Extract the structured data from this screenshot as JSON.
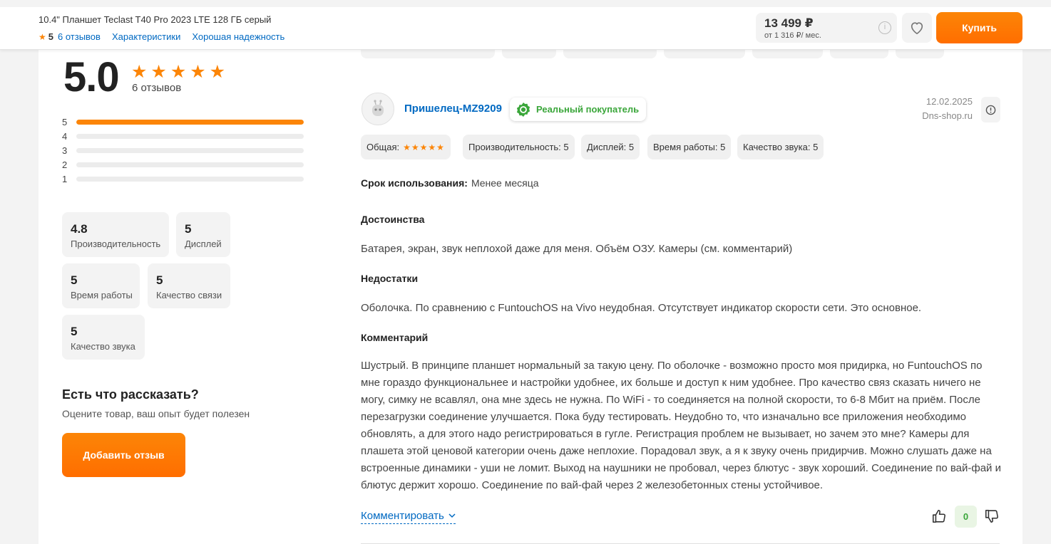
{
  "product": {
    "title": "10.4\" Планшет Teclast T40 Pro 2023 LTE 128 ГБ серый",
    "rating": "5",
    "links": [
      "6 отзывов",
      "Характеристики",
      "Хорошая надежность"
    ],
    "price": "13 499 ₽",
    "credit": "от 1 316 ₽/ мес.",
    "buy_label": "Купить"
  },
  "summary": {
    "rating": "5.0",
    "stars": "★★★★★",
    "count": "6 отзывов",
    "distribution": [
      {
        "label": "5",
        "fraction": 1.0
      },
      {
        "label": "4",
        "fraction": 0
      },
      {
        "label": "3",
        "fraction": 0
      },
      {
        "label": "2",
        "fraction": 0
      },
      {
        "label": "1",
        "fraction": 0
      }
    ],
    "stats": [
      {
        "value": "4.8",
        "label": "Производительность"
      },
      {
        "value": "5",
        "label": "Дисплей"
      },
      {
        "value": "5",
        "label": "Время работы"
      },
      {
        "value": "5",
        "label": "Качество связи"
      },
      {
        "value": "5",
        "label": "Качество звука"
      }
    ]
  },
  "cta": {
    "title": "Есть что рассказать?",
    "subtitle": "Оцените товар, ваш опыт будет полезен",
    "button": "Добавить отзыв"
  },
  "review": {
    "author": "Пришелец-MZ9209",
    "badge": "Реальный покупатель",
    "date": "12.02.2025",
    "source": "Dns-shop.ru",
    "chips": {
      "overall_label": "Общая:",
      "overall_stars": "★★★★★",
      "items": [
        "Производительность: 5",
        "Дисплей: 5",
        "Время работы: 5",
        "Качество звука: 5"
      ]
    },
    "usage_label": "Срок использования:",
    "usage_value": "Менее месяца",
    "pros_title": "Достоинства",
    "pros": "Батарея, экран, звук неплохой даже для меня. Объём ОЗУ. Камеры (см. комментарий)",
    "cons_title": "Недостатки",
    "cons": "Оболочка. По сравнению с FuntouchOS на Vivo неудобная. Отсутствует индикатор скорости сети.  Это основное.",
    "comment_title": "Комментарий",
    "comment": "Шустрый. В принципе планшет нормальный за такую цену. По оболочке - возможно просто моя придирка, но FuntouchOS по мне гораздо функциональнее и настройки удобнее, их больше и доступ к ним удобнее.  Про качество связ сказать ничего не могу, симку не всавлял, она мне здесь не нужна. По WiFi - то соединяется на полной скорости, то 6-8 Мбит на приём.  После перезагрузки соединение улучшается. Пока буду тестировать.  Неудобно то, что изначально все приложения необходимо обновлять, а для этого надо регистрироваться в гугле. Регистрация проблем не вызывает, но зачем это мне? Камеры для плашета этой ценовой категории очень даже неплохие. Порадовал звук, а я к звуку очень придирчив. Можно слушать даже на встроенные динамики - уши не ломит.  Выход на наушники не пробовал, через блютус - звук хороший. Соединение по вай-фай и блютус держит хорошо. Соединение по вай-фай через 2 железобетонных стены устойчивое.",
    "comment_link": "Комментировать",
    "votes": "0"
  },
  "colors": {
    "accent": "#fc8507",
    "link": "#0069c2",
    "green": "#3aa63a"
  }
}
